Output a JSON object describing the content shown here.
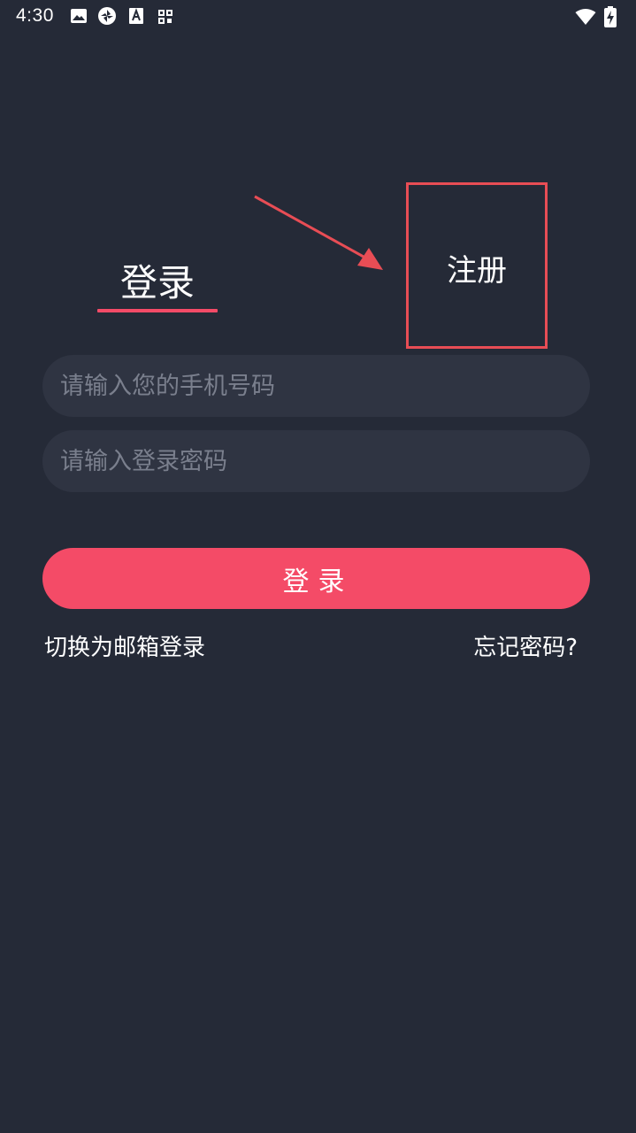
{
  "status_bar": {
    "time": "4:30",
    "icons": [
      "image-icon",
      "aperture-icon",
      "font-icon",
      "qr-icon",
      "wifi-icon",
      "battery-charging-icon"
    ]
  },
  "tabs": {
    "login_label": "登录",
    "register_label": "注册"
  },
  "form": {
    "phone_placeholder": "请输入您的手机号码",
    "password_placeholder": "请输入登录密码"
  },
  "login_button_label": "登录",
  "links": {
    "switch_email": "切换为邮箱登录",
    "forgot_password": "忘记密码?"
  },
  "colors": {
    "background": "#252a37",
    "input_background": "#2f3442",
    "accent": "#f44b67",
    "annotation": "#e84d55"
  }
}
